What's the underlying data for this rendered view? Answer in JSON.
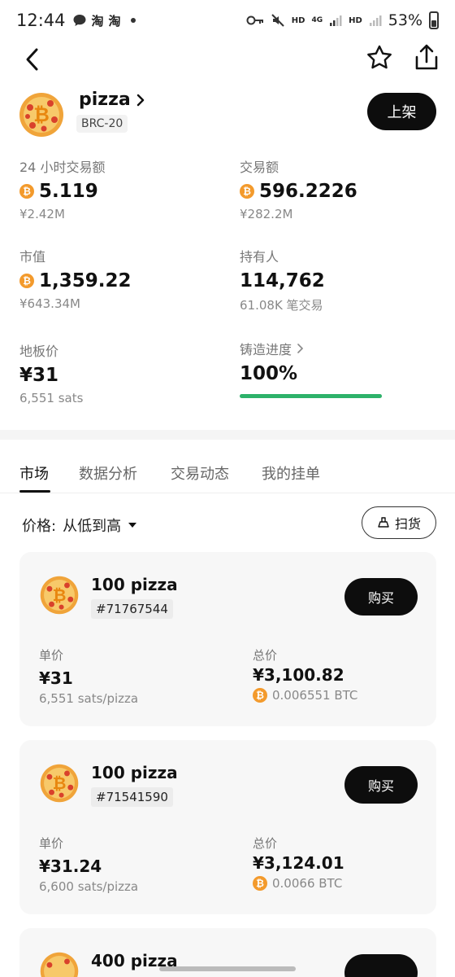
{
  "status_bar": {
    "time": "12:44",
    "left_icons": [
      "chat-icon",
      "taobao-icon",
      "taobao-icon",
      "dot-icon"
    ],
    "left_icon_text": "淘",
    "network_labels": [
      "HD",
      "4G",
      "HD"
    ],
    "battery": "53%"
  },
  "header": {
    "name": "pizza",
    "tag": "BRC-20",
    "list_button": "上架"
  },
  "stats": {
    "volume_24h": {
      "label": "24 小时交易额",
      "value": "5.119",
      "sub": "¥2.42M"
    },
    "volume_total": {
      "label": "交易额",
      "value": "596.2226",
      "sub": "¥282.2M"
    },
    "market_cap": {
      "label": "市值",
      "value": "1,359.22",
      "sub": "¥643.34M"
    },
    "holders": {
      "label": "持有人",
      "value": "114,762",
      "sub": "61.08K 笔交易"
    },
    "floor_price": {
      "label": "地板价",
      "value": "¥31",
      "sub": "6,551 sats"
    },
    "mint_progress": {
      "label": "铸造进度",
      "value": "100%",
      "fraction": 1.0
    }
  },
  "tabs": [
    "市场",
    "数据分析",
    "交易动态",
    "我的挂单"
  ],
  "sort": {
    "label": "价格:",
    "value": "从低到高",
    "sweep_label": "扫货"
  },
  "listings": [
    {
      "amount": "100 pizza",
      "id": "#71767544",
      "buy_label": "购买",
      "unit_label": "单价",
      "unit_value": "¥31",
      "unit_sub": "6,551 sats/pizza",
      "total_label": "总价",
      "total_value": "¥3,100.82",
      "total_btc": "0.006551 BTC"
    },
    {
      "amount": "100 pizza",
      "id": "#71541590",
      "buy_label": "购买",
      "unit_label": "单价",
      "unit_value": "¥31.24",
      "unit_sub": "6,600 sats/pizza",
      "total_label": "总价",
      "total_value": "¥3,124.01",
      "total_btc": "0.0066 BTC"
    },
    {
      "amount": "400 pizza"
    }
  ],
  "colors": {
    "btc_orange": "#f39a2c",
    "progress_green": "#2db26a",
    "primary_button": "#0d0d0d"
  }
}
